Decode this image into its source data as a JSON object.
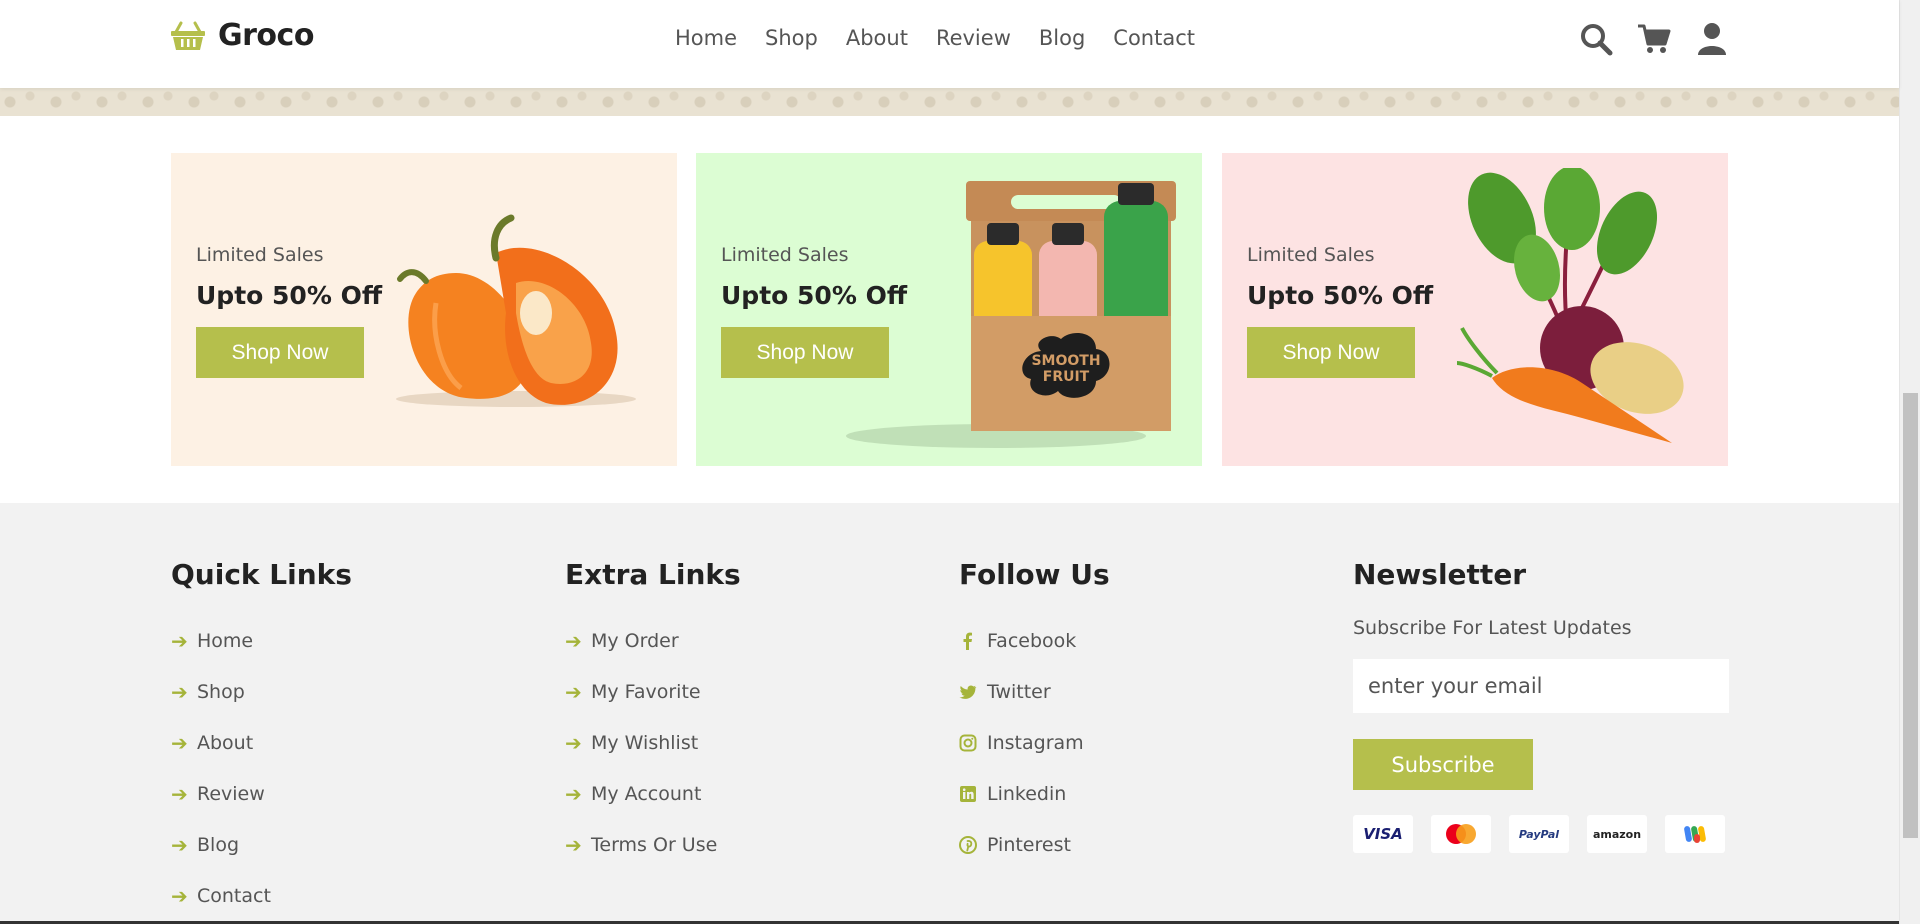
{
  "brand": {
    "name": "Groco"
  },
  "nav": [
    "Home",
    "Shop",
    "About",
    "Review",
    "Blog",
    "Contact"
  ],
  "header_icons": [
    "search-icon",
    "cart-icon",
    "user-icon"
  ],
  "promos": [
    {
      "label": "Limited Sales",
      "title": "Upto 50% Off",
      "button": "Shop Now",
      "bg": "#fdf1e4"
    },
    {
      "label": "Limited Sales",
      "title": "Upto 50% Off",
      "button": "Shop Now",
      "bg": "#dcfdd3"
    },
    {
      "label": "Limited Sales",
      "title": "Upto 50% Off",
      "button": "Shop Now",
      "bg": "#fde3e3"
    }
  ],
  "footer": {
    "quick_links": {
      "title": "Quick Links",
      "items": [
        "Home",
        "Shop",
        "About",
        "Review",
        "Blog",
        "Contact"
      ]
    },
    "extra_links": {
      "title": "Extra Links",
      "items": [
        "My Order",
        "My Favorite",
        "My Wishlist",
        "My Account",
        "Terms Or Use"
      ]
    },
    "follow_us": {
      "title": "Follow Us",
      "items": [
        "Facebook",
        "Twitter",
        "Instagram",
        "Linkedin",
        "Pinterest"
      ]
    },
    "newsletter": {
      "title": "Newsletter",
      "subtitle": "Subscribe For Latest Updates",
      "placeholder": "enter your email",
      "button": "Subscribe",
      "payment_cards": [
        "VISA",
        "",
        "PayPal",
        "amazon",
        ""
      ]
    }
  },
  "colors": {
    "accent": "#b5bf4c",
    "footer_bg": "#f2f2f2"
  }
}
